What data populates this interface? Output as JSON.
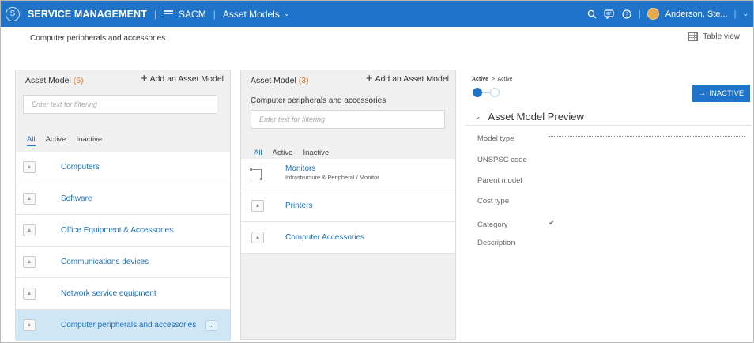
{
  "topbar": {
    "app_title": "SERVICE MANAGEMENT",
    "module": "SACM",
    "section": "Asset Models",
    "user": "Anderson, Ste...",
    "accent": "#1f73c8"
  },
  "subheader": {
    "title": "Computer peripherals and accessories",
    "table_view": "Table view"
  },
  "panel1": {
    "title": "Asset Model",
    "count": "(6)",
    "add": "Add an Asset Model",
    "filter_placeholder": "Enter text for filtering",
    "tabs": [
      "All",
      "Active",
      "Inactive"
    ],
    "items": [
      {
        "label": "Computers"
      },
      {
        "label": "Software"
      },
      {
        "label": "Office Equipment & Accessories"
      },
      {
        "label": "Communications devices"
      },
      {
        "label": "Network service equipment"
      },
      {
        "label": "Computer peripherals and accessories",
        "selected": true
      }
    ]
  },
  "panel2": {
    "title": "Asset Model",
    "count": "(3)",
    "add": "Add an Asset Model",
    "subtitle": "Computer peripherals and accessories",
    "filter_placeholder": "Enter text for filtering",
    "tabs": [
      "All",
      "Active",
      "Inactive"
    ],
    "items": [
      {
        "label": "Monitors",
        "path": "Infrastructure & Peripheral / Monitor"
      },
      {
        "label": "Printers"
      },
      {
        "label": "Computer Accessories"
      }
    ]
  },
  "preview": {
    "status_from": "Active",
    "status_to": "Active",
    "inactive_button": "INACTIVE",
    "heading": "Asset Model Preview",
    "fields": [
      "Model type",
      "UNSPSC code",
      "Parent model",
      "Cost type",
      "Category",
      "Description"
    ]
  }
}
